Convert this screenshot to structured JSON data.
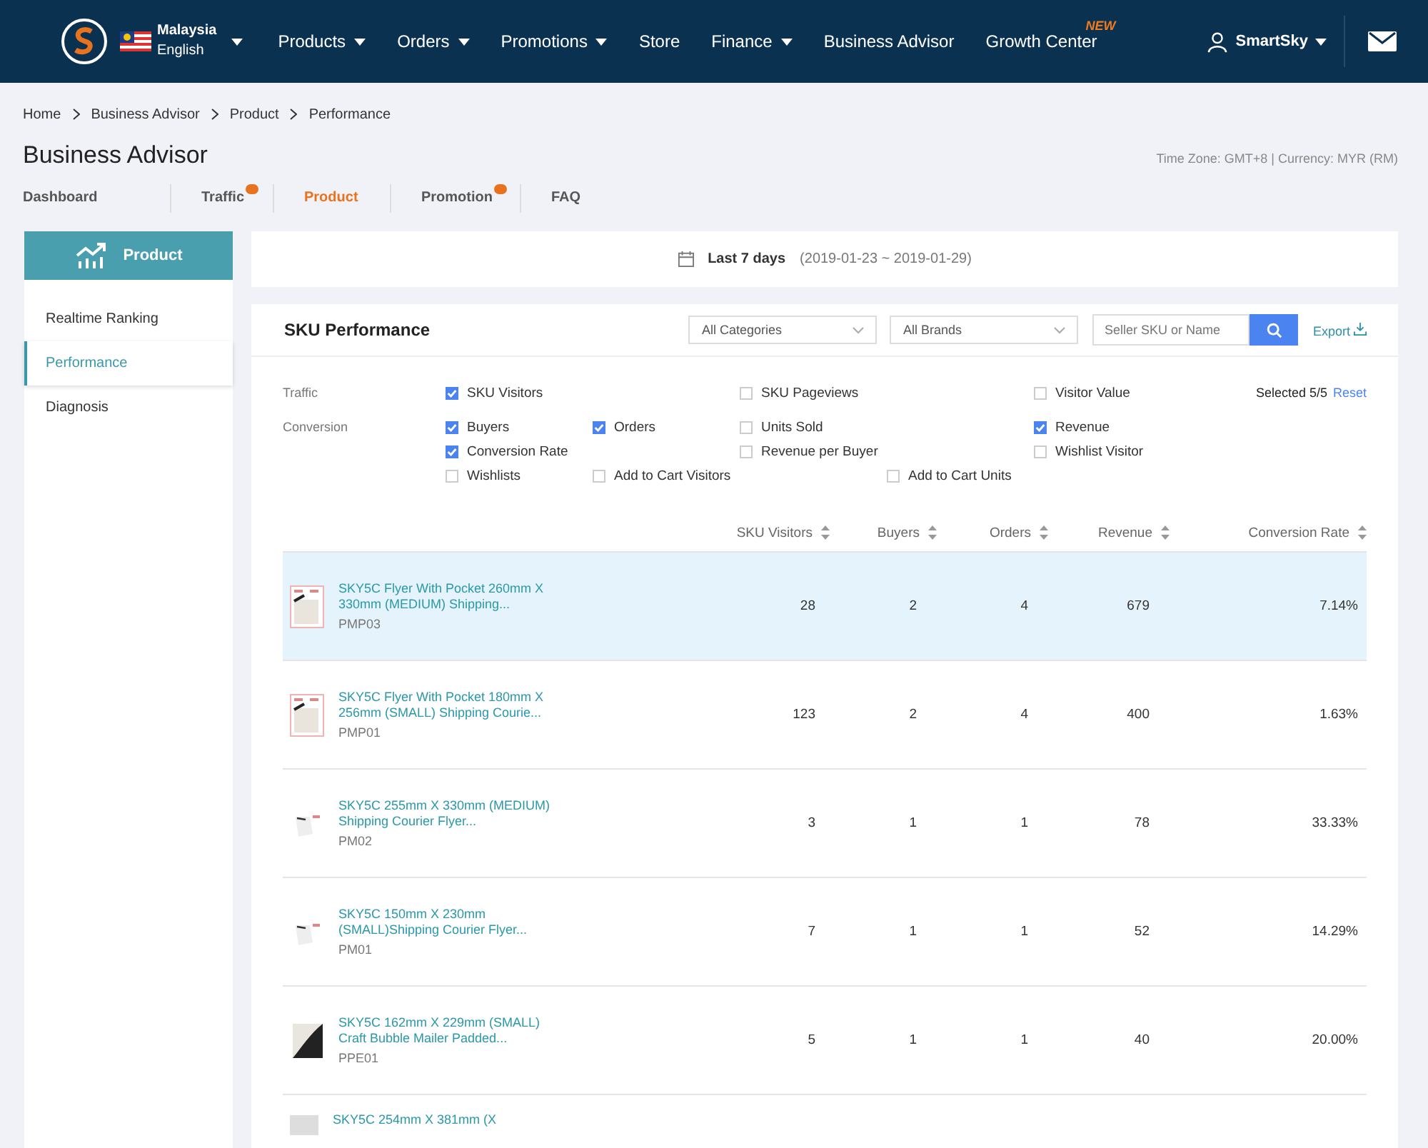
{
  "nav": {
    "country": "Malaysia",
    "language": "English",
    "items": [
      {
        "label": "Products",
        "dropdown": true
      },
      {
        "label": "Orders",
        "dropdown": true
      },
      {
        "label": "Promotions",
        "dropdown": true
      },
      {
        "label": "Store",
        "dropdown": false
      },
      {
        "label": "Finance",
        "dropdown": true
      },
      {
        "label": "Business Advisor",
        "dropdown": false
      },
      {
        "label": "Growth Center",
        "dropdown": false,
        "badge": "NEW"
      }
    ],
    "user": "SmartSky"
  },
  "breadcrumb": [
    "Home",
    "Business Advisor",
    "Product",
    "Performance"
  ],
  "page_title": "Business Advisor",
  "timezone": "Time Zone: GMT+8 | Currency: MYR (RM)",
  "tabs": [
    {
      "label": "Dashboard",
      "selected": false,
      "dot": false
    },
    {
      "label": "Traffic",
      "selected": false,
      "dot": true
    },
    {
      "label": "Product",
      "selected": true,
      "dot": false
    },
    {
      "label": "Promotion",
      "selected": false,
      "dot": true
    },
    {
      "label": "FAQ",
      "selected": false,
      "dot": false
    }
  ],
  "sidebar": {
    "header": "Product",
    "items": [
      {
        "label": "Realtime Ranking",
        "selected": false
      },
      {
        "label": "Performance",
        "selected": true
      },
      {
        "label": "Diagnosis",
        "selected": false
      }
    ]
  },
  "date_range": {
    "label": "Last 7 days",
    "range": "(2019-01-23 ~ 2019-01-29)"
  },
  "sku": {
    "title": "SKU Performance",
    "category": "All Categories",
    "brand": "All Brands",
    "search_placeholder": "Seller SKU or Name",
    "export": "Export",
    "metric_groups": [
      {
        "label": "Traffic",
        "metrics": [
          {
            "label": "SKU Visitors",
            "checked": true
          },
          {
            "label": "SKU Pageviews",
            "checked": false
          },
          {
            "label": "Visitor Value",
            "checked": false
          }
        ]
      },
      {
        "label": "Conversion",
        "metrics": [
          {
            "label": "Buyers",
            "checked": true
          },
          {
            "label": "Orders",
            "checked": true
          },
          {
            "label": "Units Sold",
            "checked": false
          },
          {
            "label": "Revenue",
            "checked": true
          },
          {
            "label": "Conversion Rate",
            "checked": true
          },
          {
            "label": "Revenue per Buyer",
            "checked": false
          },
          {
            "label": "Wishlist Visitor",
            "checked": false
          },
          {
            "label": "Wishlists",
            "checked": false
          },
          {
            "label": "Add to Cart Visitors",
            "checked": false
          },
          {
            "label": "Add to Cart Units",
            "checked": false
          }
        ]
      }
    ],
    "selected_count": "Selected 5/5",
    "reset": "Reset",
    "columns": [
      "SKU Visitors",
      "Buyers",
      "Orders",
      "Revenue",
      "Conversion Rate"
    ],
    "rows": [
      {
        "name": "SKY5C Flyer With Pocket 260mm X 330mm (MEDIUM) Shipping...",
        "sku": "PMP03",
        "values": [
          "28",
          "2",
          "4",
          "679",
          "7.14%"
        ],
        "selected": true,
        "kind": "flyer"
      },
      {
        "name": "SKY5C Flyer With Pocket 180mm X 256mm (SMALL) Shipping Courie...",
        "sku": "PMP01",
        "values": [
          "123",
          "2",
          "4",
          "400",
          "1.63%"
        ],
        "selected": false,
        "kind": "flyer"
      },
      {
        "name": "SKY5C 255mm X 330mm (MEDIUM) Shipping Courier Flyer...",
        "sku": "PM02",
        "values": [
          "3",
          "1",
          "1",
          "78",
          "33.33%"
        ],
        "selected": false,
        "kind": "plain"
      },
      {
        "name": "SKY5C 150mm X 230mm (SMALL)Shipping Courier Flyer...",
        "sku": "PM01",
        "values": [
          "7",
          "1",
          "1",
          "52",
          "14.29%"
        ],
        "selected": false,
        "kind": "plain"
      },
      {
        "name": "SKY5C 162mm X 229mm (SMALL) Craft Bubble Mailer Padded...",
        "sku": "PPE01",
        "values": [
          "5",
          "1",
          "1",
          "40",
          "20.00%"
        ],
        "selected": false,
        "kind": "bubble"
      }
    ],
    "partial_row": "SKY5C 254mm X 381mm (X"
  }
}
